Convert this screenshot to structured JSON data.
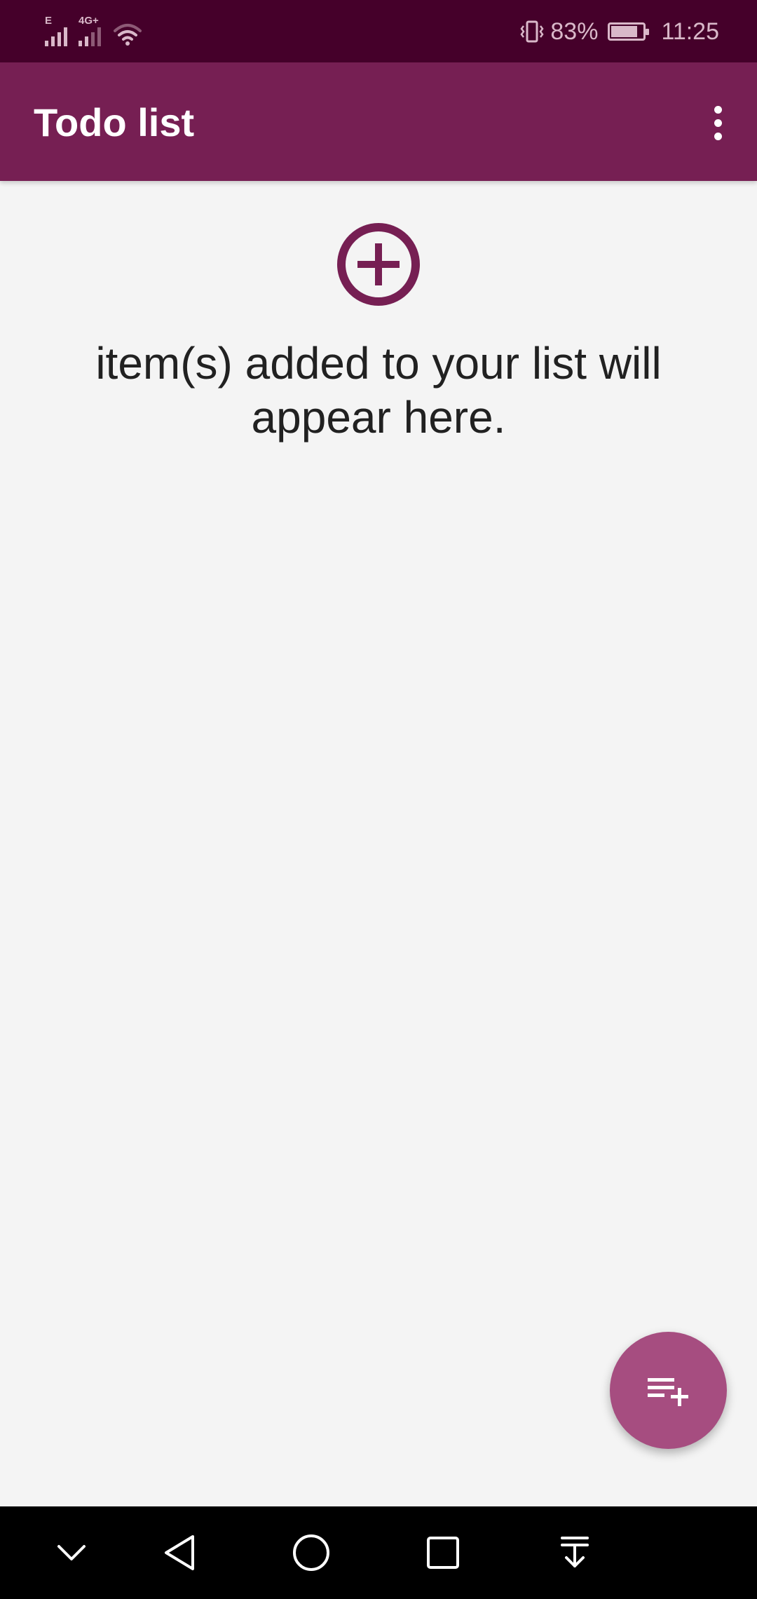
{
  "status_bar": {
    "network_1": "E",
    "network_2": "4G+",
    "battery_percent": "83%",
    "battery_level": 0.83,
    "time": "11:25",
    "icons": [
      "signal-icon",
      "signal-icon",
      "wifi-icon",
      "vibrate-icon",
      "battery-icon"
    ]
  },
  "app_bar": {
    "title": "Todo list",
    "menu_icon": "more-vert-icon"
  },
  "empty_state": {
    "icon": "add-circle-icon",
    "message": "item(s) added to your list will appear here."
  },
  "fab": {
    "icon": "playlist-add-icon"
  },
  "nav_bar": {
    "buttons": [
      "chevron-down-icon",
      "back-icon",
      "home-icon",
      "recents-icon",
      "notifications-pull-icon"
    ]
  },
  "colors": {
    "status_bar": "#45002a",
    "app_bar": "#761f53",
    "accent": "#761f53",
    "fab": "#a64d80",
    "background": "#f4f4f4",
    "nav_bar": "#000000"
  }
}
